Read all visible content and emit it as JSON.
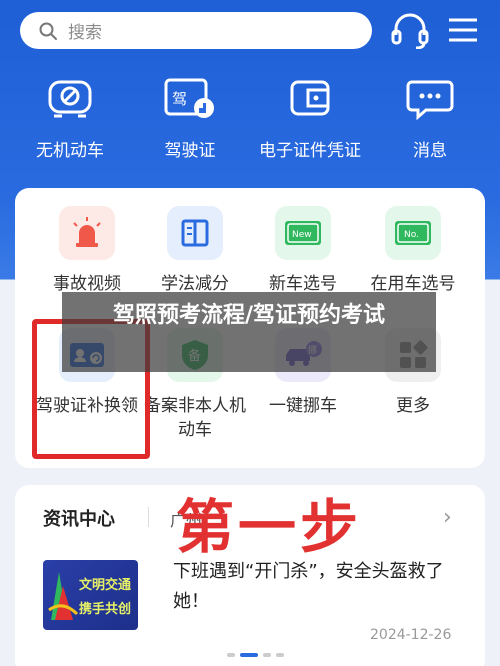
{
  "search": {
    "placeholder": "搜索"
  },
  "quick": [
    {
      "label": "无机动车",
      "icon": "no-vehicle-icon"
    },
    {
      "label": "驾驶证",
      "icon": "driver-license-icon"
    },
    {
      "label": "电子证件凭证",
      "icon": "e-wallet-icon"
    },
    {
      "label": "消息",
      "icon": "message-icon"
    }
  ],
  "services": [
    {
      "label": "事故视频",
      "icon": "accident-alarm-icon"
    },
    {
      "label": "学法减分",
      "icon": "study-book-icon"
    },
    {
      "label": "新车选号",
      "icon": "new-plate-icon",
      "badge": "New"
    },
    {
      "label": "在用车选号",
      "icon": "used-plate-icon",
      "badge": "No."
    },
    {
      "label": "驾驶证补换领",
      "icon": "license-reissue-icon"
    },
    {
      "label": "备案非本人机动车",
      "icon": "filing-shield-icon",
      "badge": "备"
    },
    {
      "label": "一键挪车",
      "icon": "move-car-icon",
      "badge": "挪"
    },
    {
      "label": "更多",
      "icon": "more-grid-icon"
    }
  ],
  "overlay": {
    "title": "驾照预考流程/驾证预约考试"
  },
  "annotation": {
    "step": "第一步"
  },
  "news": {
    "header": "资讯中心",
    "location": "广州",
    "item_title": "下班遇到“开门杀”，安全头盔救了她！",
    "date": "2024-12-26",
    "thumb_line1": "文明交通",
    "thumb_line2": "携手共创"
  },
  "colors": {
    "brand_blue": "#2a6be0",
    "red_annotation": "#e02a2a"
  }
}
